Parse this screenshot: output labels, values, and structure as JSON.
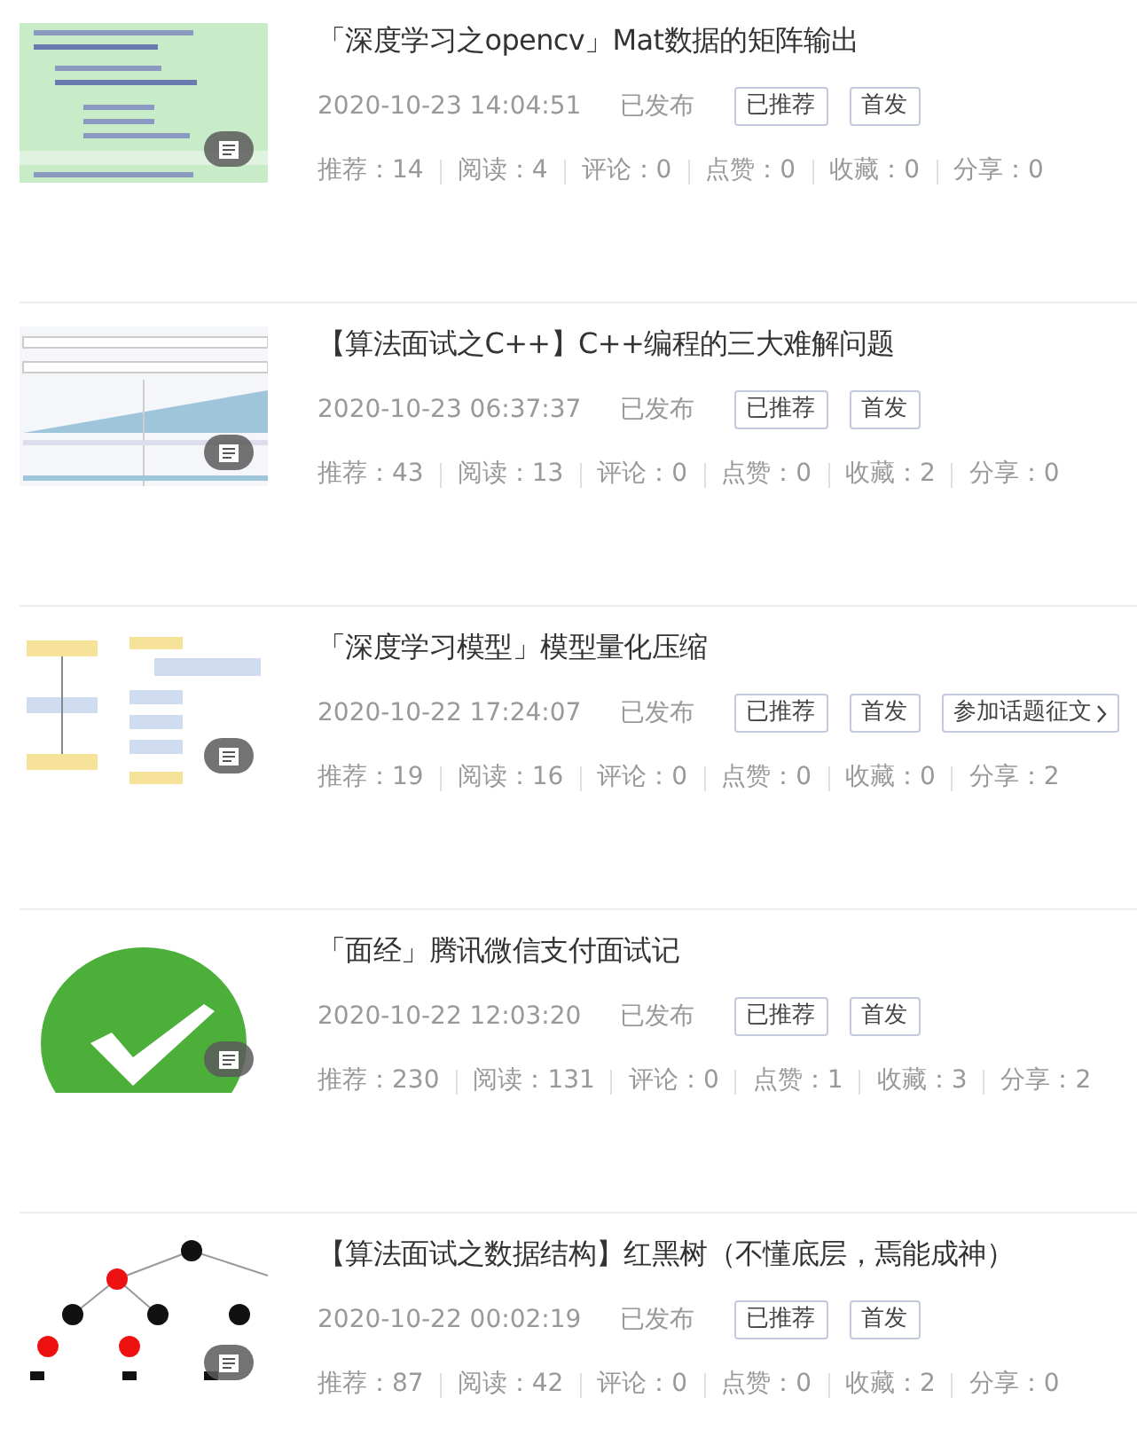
{
  "articles": [
    {
      "thumbnail": {
        "kind": "picture"
      },
      "title": "「深度学习之opencv」Mat数据的矩阵输出",
      "date": "2020-10-23 14:04:51",
      "status": "已发布",
      "tags": [
        {
          "label": "已推荐",
          "kind": "tag"
        },
        {
          "label": "首发",
          "kind": "tag"
        }
      ],
      "stats": [
        "推荐：14",
        "阅读：4",
        "评论：0",
        "点赞：0",
        "收藏：0",
        "分享：0"
      ]
    },
    {
      "thumbnail": {
        "kind": "picture"
      },
      "title": "【算法面试之C++】C++编程的三大难解问题",
      "date": "2020-10-23 06:37:37",
      "status": "已发布",
      "tags": [
        {
          "label": "已推荐",
          "kind": "tag"
        },
        {
          "label": "首发",
          "kind": "tag"
        }
      ],
      "stats": [
        "推荐：43",
        "阅读：13",
        "评论：0",
        "点赞：0",
        "收藏：2",
        "分享：0"
      ]
    },
    {
      "thumbnail": {
        "kind": "picture"
      },
      "title": "「深度学习模型」模型量化压缩",
      "date": "2020-10-22 17:24:07",
      "status": "已发布",
      "tags": [
        {
          "label": "已推荐",
          "kind": "tag"
        },
        {
          "label": "首发",
          "kind": "tag"
        },
        {
          "label": "参加话题征文",
          "kind": "link"
        }
      ],
      "stats": [
        "推荐：19",
        "阅读：16",
        "评论：0",
        "点赞：0",
        "收藏：0",
        "分享：2"
      ]
    },
    {
      "thumbnail": {
        "kind": "picture"
      },
      "title": "「面经」腾讯微信支付面试记",
      "date": "2020-10-22 12:03:20",
      "status": "已发布",
      "tags": [
        {
          "label": "已推荐",
          "kind": "tag"
        },
        {
          "label": "首发",
          "kind": "tag"
        }
      ],
      "stats": [
        "推荐：230",
        "阅读：131",
        "评论：0",
        "点赞：1",
        "收藏：3",
        "分享：2"
      ]
    },
    {
      "thumbnail": {
        "kind": "picture"
      },
      "title": "【算法面试之数据结构】红黑树（不懂底层，焉能成神）",
      "date": "2020-10-22 00:02:19",
      "status": "已发布",
      "tags": [
        {
          "label": "已推荐",
          "kind": "tag"
        },
        {
          "label": "首发",
          "kind": "tag"
        }
      ],
      "stats": [
        "推荐：87",
        "阅读：42",
        "评论：0",
        "点赞：0",
        "收藏：2",
        "分享：0"
      ]
    }
  ]
}
